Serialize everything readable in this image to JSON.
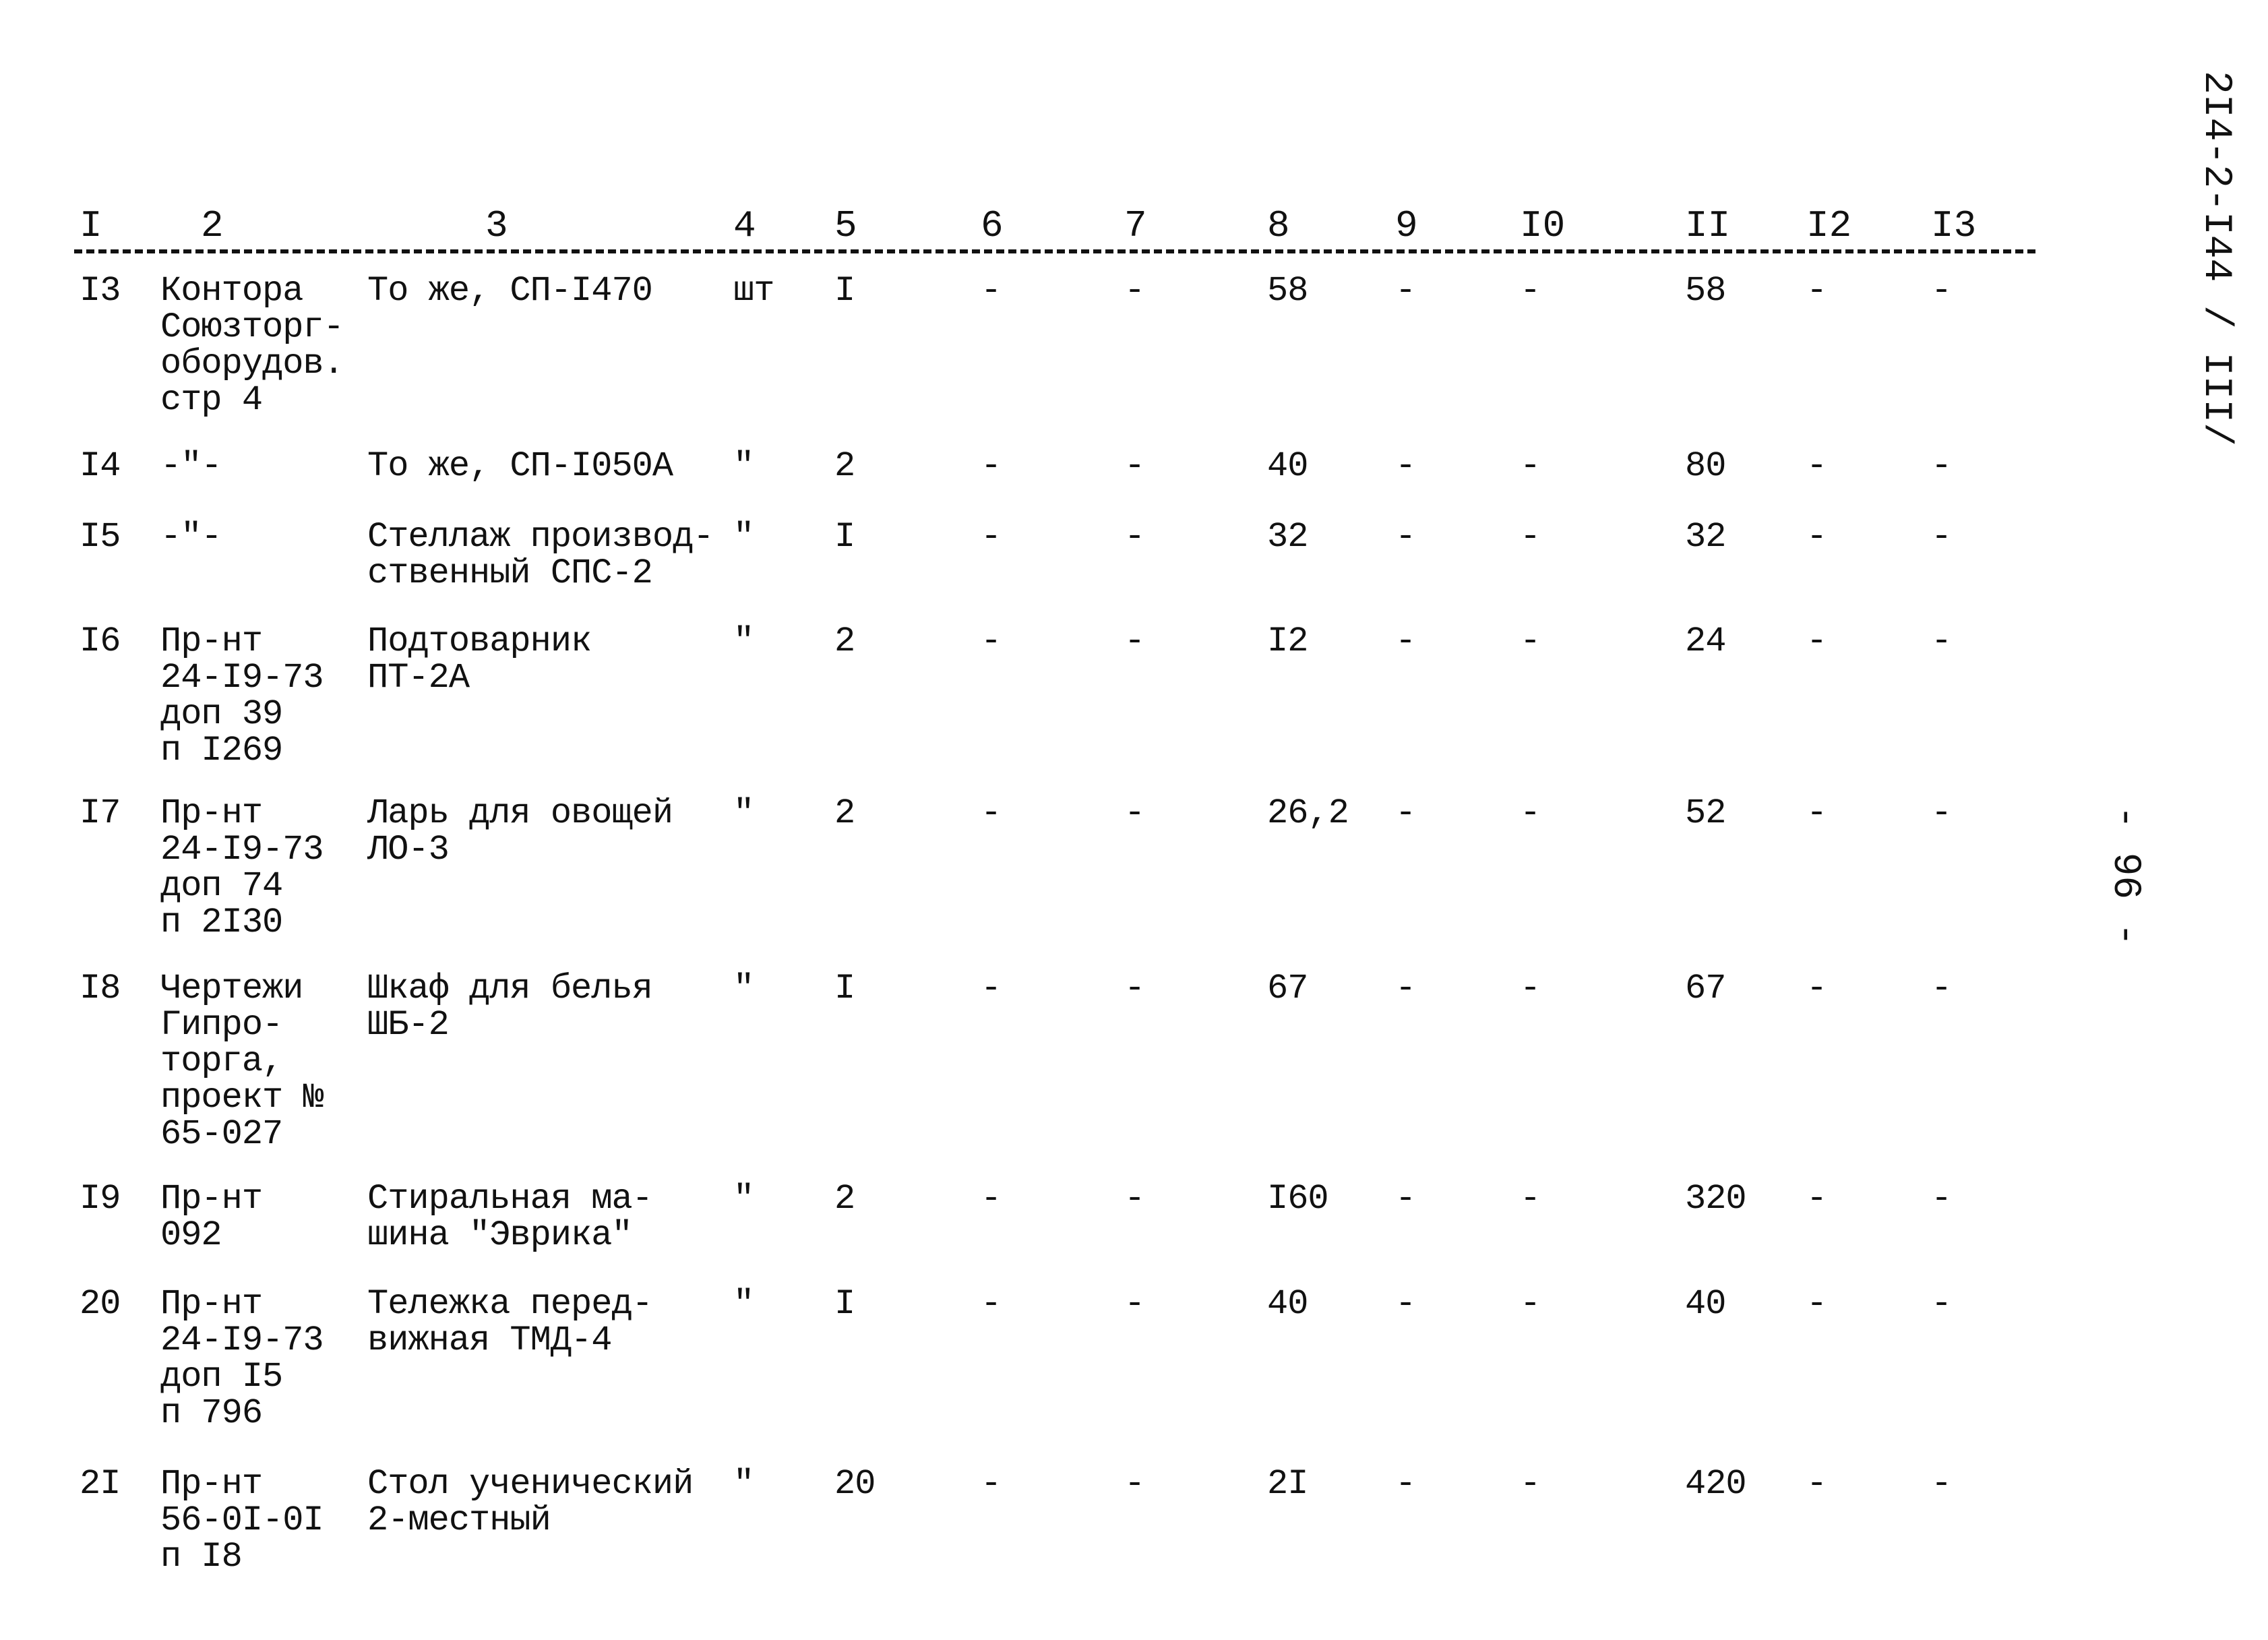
{
  "document": {
    "side_code": "2I4-2-I44 / III/",
    "page_number": "- 96 -"
  },
  "header": {
    "columns": [
      "I",
      "2",
      "3",
      "4",
      "5",
      "6",
      "7",
      "8",
      "9",
      "I0",
      "II",
      "I2",
      "I3"
    ]
  },
  "rows": [
    {
      "c1": "I3",
      "c2": "Контора\nСоюзторг-\nоборудов.\nстр 4",
      "c3": "То же, СП-I470",
      "c4": "шт",
      "c5": "I",
      "c6": "-",
      "c7": "-",
      "c8": "58",
      "c9": "-",
      "c10": "-",
      "c11": "58",
      "c12": "-",
      "c13": "-"
    },
    {
      "c1": "I4",
      "c2": "-\"-",
      "c3": "То же, СП-I050А",
      "c4": "\"",
      "c5": "2",
      "c6": "-",
      "c7": "-",
      "c8": "40",
      "c9": "-",
      "c10": "-",
      "c11": "80",
      "c12": "-",
      "c13": "-"
    },
    {
      "c1": "I5",
      "c2": "-\"-",
      "c3": "Стеллаж производ-\nственный СПС-2",
      "c4": "\"",
      "c5": "I",
      "c6": "-",
      "c7": "-",
      "c8": "32",
      "c9": "-",
      "c10": "-",
      "c11": "32",
      "c12": "-",
      "c13": "-"
    },
    {
      "c1": "I6",
      "c2": "Пр-нт\n24-I9-73\nдоп 39\nп I269",
      "c3": "Подтоварник\nПТ-2А",
      "c4": "\"",
      "c5": "2",
      "c6": "-",
      "c7": "-",
      "c8": "I2",
      "c9": "-",
      "c10": "-",
      "c11": "24",
      "c12": "-",
      "c13": "-"
    },
    {
      "c1": "I7",
      "c2": "Пр-нт\n24-I9-73\nдоп 74\nп 2I30",
      "c3": "Ларь для овощей\nЛО-3",
      "c4": "\"",
      "c5": "2",
      "c6": "-",
      "c7": "-",
      "c8": "26,2",
      "c9": "-",
      "c10": "-",
      "c11": "52",
      "c12": "-",
      "c13": "-"
    },
    {
      "c1": "I8",
      "c2": "Чертежи\nГипро-\nторга,\nпроект №\n65-027",
      "c3": "Шкаф для белья\nШБ-2",
      "c4": "\"",
      "c5": "I",
      "c6": "-",
      "c7": "-",
      "c8": "67",
      "c9": "-",
      "c10": "-",
      "c11": "67",
      "c12": "-",
      "c13": "-"
    },
    {
      "c1": "I9",
      "c2": "Пр-нт\n092",
      "c3": "Стиральная ма-\nшина \"Эврика\"",
      "c4": "\"",
      "c5": "2",
      "c6": "-",
      "c7": "-",
      "c8": "I60",
      "c9": "-",
      "c10": "-",
      "c11": "320",
      "c12": "-",
      "c13": "-"
    },
    {
      "c1": "20",
      "c2": "Пр-нт\n24-I9-73\nдоп I5\nп 796",
      "c3": "Тележка перед-\nвижная ТМД-4",
      "c4": "\"",
      "c5": "I",
      "c6": "-",
      "c7": "-",
      "c8": "40",
      "c9": "-",
      "c10": "-",
      "c11": "40",
      "c12": "-",
      "c13": "-"
    },
    {
      "c1": "2I",
      "c2": "Пр-нт\n56-0I-0I\nп I8",
      "c3": "Стол ученический\n2-местный",
      "c4": "\"",
      "c5": "20",
      "c6": "-",
      "c7": "-",
      "c8": "2I",
      "c9": "-",
      "c10": "-",
      "c11": "420",
      "c12": "-",
      "c13": "-"
    }
  ]
}
